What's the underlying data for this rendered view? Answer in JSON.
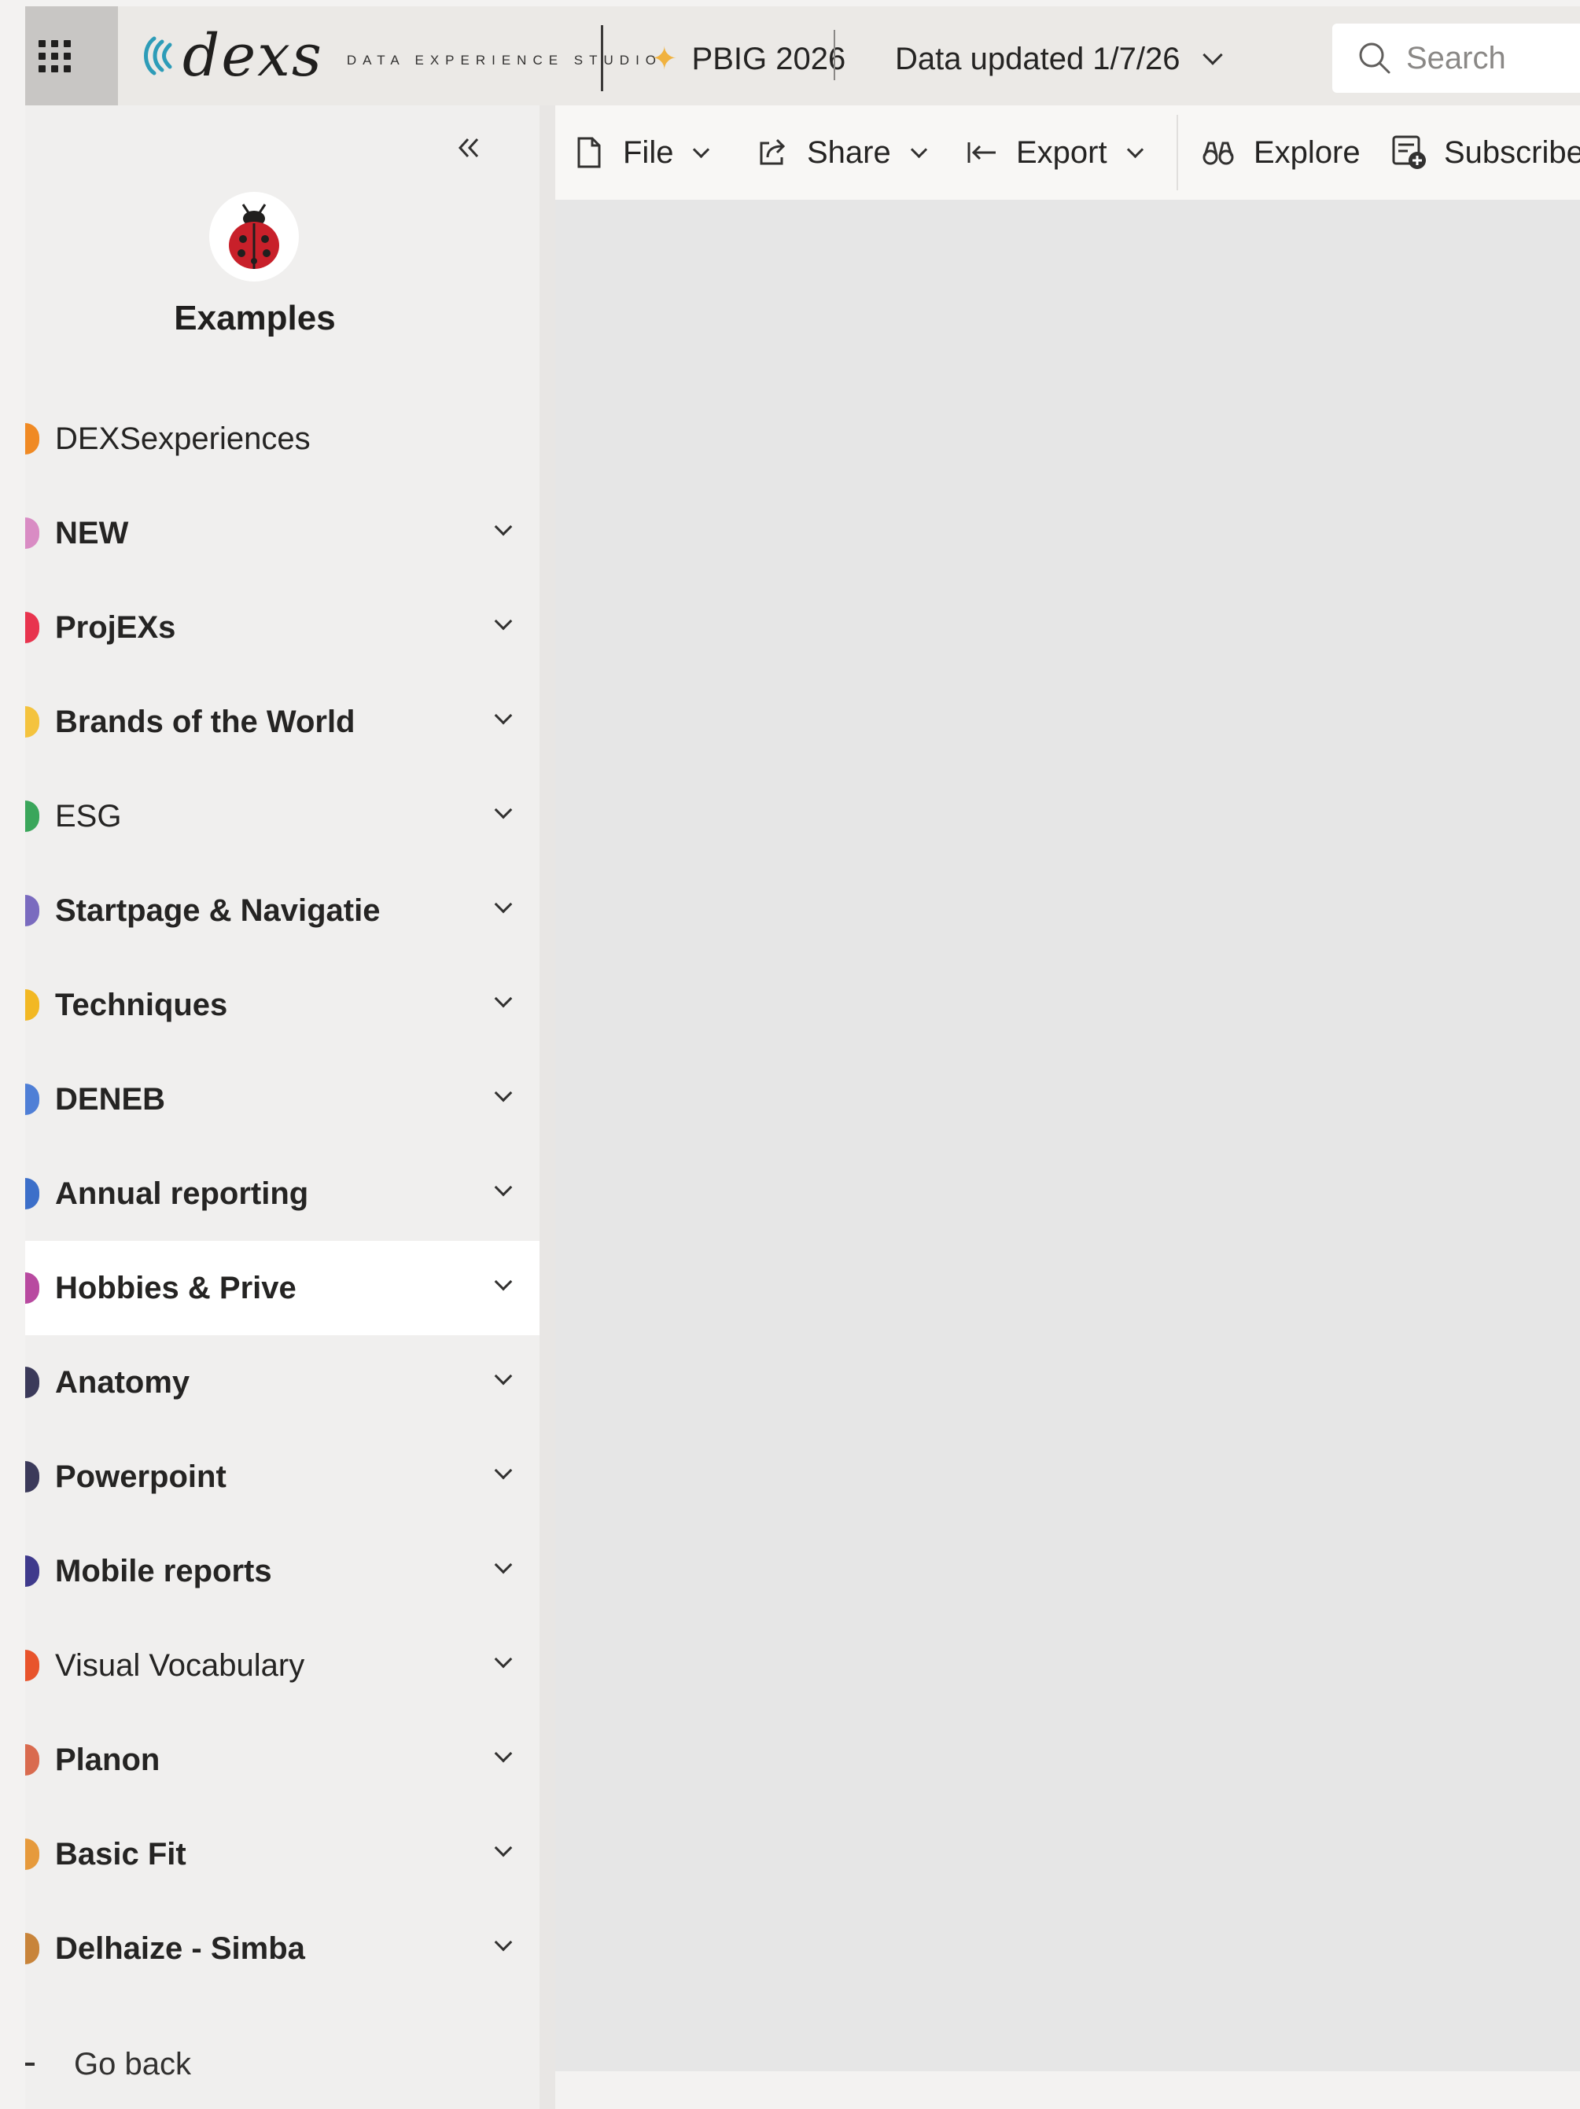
{
  "header": {
    "brand_name": "dexs",
    "brand_tagline": "DATA EXPERIENCE STUDIO",
    "workspace_name": "PBIG 2026",
    "data_updated": "Data updated 1/7/26",
    "search_placeholder": "Search"
  },
  "sidebar": {
    "workspace_title": "Examples",
    "items": [
      {
        "label": "DEXSexperiences",
        "icon_color": "#f08a24",
        "expandable": false
      },
      {
        "label": "NEW",
        "icon_color": "#d98cc4",
        "expandable": true
      },
      {
        "label": "ProjEXs",
        "icon_color": "#e8344e",
        "expandable": true
      },
      {
        "label": "Brands of the World",
        "icon_color": "#f4c33e",
        "expandable": true
      },
      {
        "label": "ESG",
        "icon_color": "#3aa65b",
        "expandable": true
      },
      {
        "label": "Startpage & Navigatie",
        "icon_color": "#7a6bbf",
        "expandable": true
      },
      {
        "label": "Techniques",
        "icon_color": "#f2b824",
        "expandable": true
      },
      {
        "label": "DENEB",
        "icon_color": "#4f7fd6",
        "expandable": true
      },
      {
        "label": "Annual reporting",
        "icon_color": "#3c6fc9",
        "expandable": true
      },
      {
        "label": "Hobbies & Prive",
        "icon_color": "#b84aa0",
        "expandable": true
      },
      {
        "label": "Anatomy",
        "icon_color": "#3b3a5a",
        "expandable": true
      },
      {
        "label": "Powerpoint",
        "icon_color": "#3b3a5a",
        "expandable": true
      },
      {
        "label": "Mobile reports",
        "icon_color": "#3f3a8c",
        "expandable": true
      },
      {
        "label": "Visual Vocabulary",
        "icon_color": "#e8542c",
        "expandable": true
      },
      {
        "label": "Planon",
        "icon_color": "#d96b4f",
        "expandable": true
      },
      {
        "label": "Basic Fit",
        "icon_color": "#e69a3c",
        "expandable": true
      },
      {
        "label": "Delhaize - Simba",
        "icon_color": "#c8843a",
        "expandable": true
      }
    ],
    "active_index": 9,
    "go_back": "Go back"
  },
  "commandbar": {
    "file": "File",
    "share": "Share",
    "export": "Export",
    "explore": "Explore",
    "subscribe": "Subscribe"
  },
  "colors": {
    "header_bg": "#ebe9e6",
    "sidebar_bg": "#f0efee",
    "canvas_bg": "#e6e6e6",
    "accent_star": "#f0b23f"
  }
}
